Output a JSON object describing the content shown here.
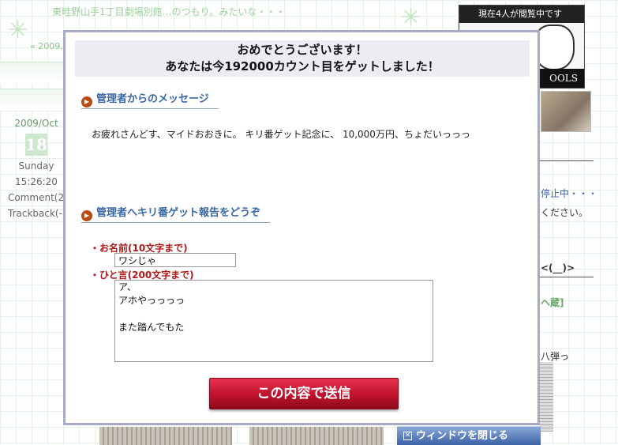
{
  "background": {
    "blog_title": "東畦野山手1丁目劇場別館…のつもり。みたいな・・・",
    "nav_prev": "« 2009.1",
    "entry": {
      "month": "2009/Oct",
      "day": "18",
      "weekday": "Sunday",
      "time": "15:26:20",
      "comment": "Comment(2",
      "trackback": "Trackback(-"
    },
    "right": {
      "banner_top": "現在4人が閲覧中です",
      "banner_bottom": "OOLS",
      "text_stop": "停止中・・・",
      "text_please": "ください。",
      "text_face": "<(__)>",
      "text_kura": "ヘ蔵]",
      "text_yatsu": "八弾っ"
    },
    "close_window_label": "ウィンドウを閉じる"
  },
  "modal": {
    "title_line1": "おめでとうございます！",
    "title_line2": "あなたは今192000カウント目をゲットしました！",
    "message_heading": "管理者からのメッセージ",
    "message_text": "お疲れさんどす、マイドおおきに。 キリ番ゲット記念に、 10,000万円、ちょだいっっっ",
    "report_heading": "管理者へキリ番ゲット報告をどうぞ",
    "name_label": "・お名前(10文字まで)",
    "name_value": "ワシじゃ",
    "comment_label": "・ひと言(200文字まで)",
    "comment_value": "ア、\nアホやっっっっ\n\nまた踏んでもた",
    "submit_label": "この内容で送信"
  },
  "colors": {
    "accent_red": "#c0122d",
    "heading_blue": "#3b66a6",
    "label_red": "#b01818",
    "modal_border": "#a7abc6",
    "close_bar_blue": "#3c62a6"
  }
}
